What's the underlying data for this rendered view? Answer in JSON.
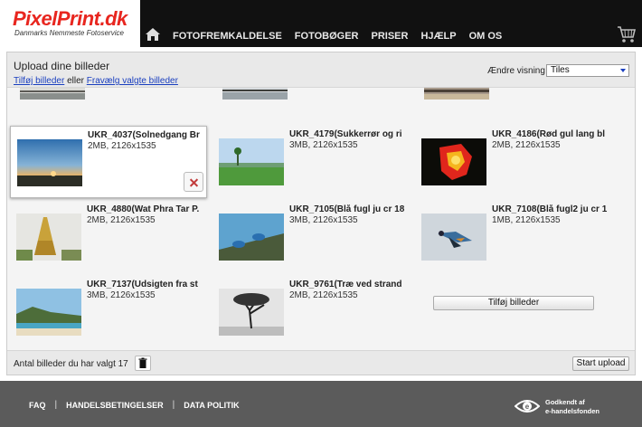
{
  "brand": {
    "name": "PixelPrint.dk",
    "tagline": "Danmarks Nemmeste Fotoservice"
  },
  "nav": [
    "FOTOFREMKALDELSE",
    "FOTOBØGER",
    "PRISER",
    "HJÆLP",
    "OM OS"
  ],
  "panel": {
    "title": "Upload dine billeder",
    "add_link": "Tilføj billeder",
    "or_text": " eller ",
    "deselect_link": "Fravælg valgte billeder",
    "view_label": "Ændre visning",
    "view_value": "Tiles"
  },
  "tiles": [
    {
      "name": "UKR_4037(Solnedgang Br",
      "meta": "2MB, 2126x1535"
    },
    {
      "name": "UKR_4179(Sukkerrør og ri",
      "meta": "3MB, 2126x1535"
    },
    {
      "name": "UKR_4186(Rød gul lang bl",
      "meta": "2MB, 2126x1535"
    },
    {
      "name": "UKR_4880(Wat Phra Tar P.",
      "meta": "2MB, 2126x1535"
    },
    {
      "name": "UKR_7105(Blå fugl ju cr 18",
      "meta": "3MB, 2126x1535"
    },
    {
      "name": "UKR_7108(Blå fugl2 ju cr 1",
      "meta": "1MB, 2126x1535"
    },
    {
      "name": "UKR_7137(Udsigten fra st",
      "meta": "3MB, 2126x1535"
    },
    {
      "name": "UKR_9761(Træ ved strand",
      "meta": "2MB, 2126x1535"
    }
  ],
  "add_button": "Tilføj billeder",
  "bottom": {
    "count_text": "Antal billeder du har valgt 17",
    "start_button": "Start upload"
  },
  "footer": {
    "links": [
      "FAQ",
      "HANDELSBETINGELSER",
      "DATA POLITIK"
    ],
    "badge_line1": "Godkendt af",
    "badge_line2": "e-handelsfonden"
  },
  "colors": {
    "brand_red": "#e8261f",
    "topbar": "#111111",
    "footer": "#5b5b5b",
    "link_blue": "#1a3fbf"
  }
}
